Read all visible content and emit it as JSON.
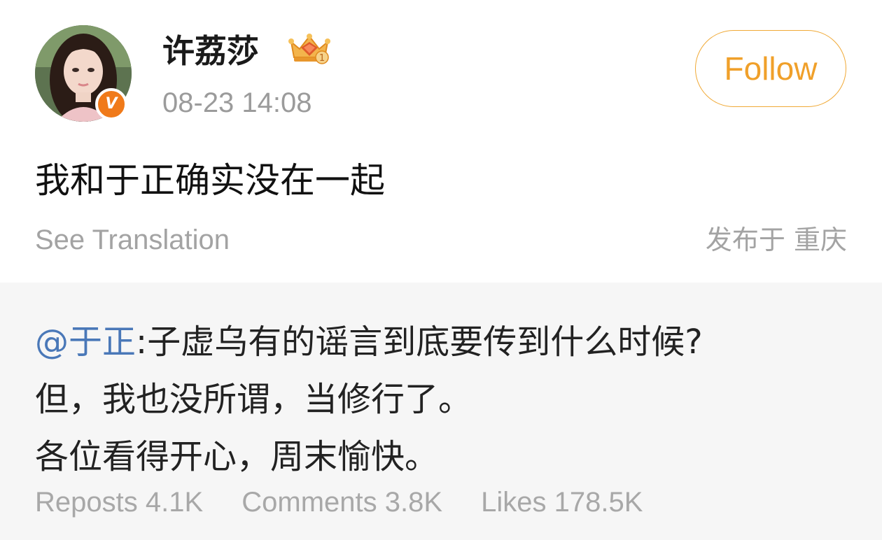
{
  "post": {
    "author": {
      "name": "许荔莎",
      "verified_mark": "V",
      "vip_badge_number": "1"
    },
    "timestamp": "08-23 14:08",
    "follow_label": "Follow",
    "text": "我和于正确实没在一起",
    "see_translation": "See Translation",
    "location": "发布于 重庆"
  },
  "repost": {
    "mention": "@于正",
    "separator": ":",
    "lines": [
      "子虚乌有的谣言到底要传到什么时候?",
      "但，我也没所谓，当修行了。",
      "各位看得开心，周末愉快。"
    ],
    "stats": {
      "reposts": "Reposts 4.1K",
      "comments": "Comments 3.8K",
      "likes": "Likes 178.5K"
    }
  },
  "colors": {
    "accent_follow": "#f0a02a",
    "mention_blue": "#4a78b8",
    "verified_orange": "#f07a1a",
    "muted_gray": "#a3a3a3",
    "repost_background": "#f6f6f6"
  },
  "icons": {
    "verified": "verified-v-icon",
    "vip": "vip-crown-icon"
  }
}
